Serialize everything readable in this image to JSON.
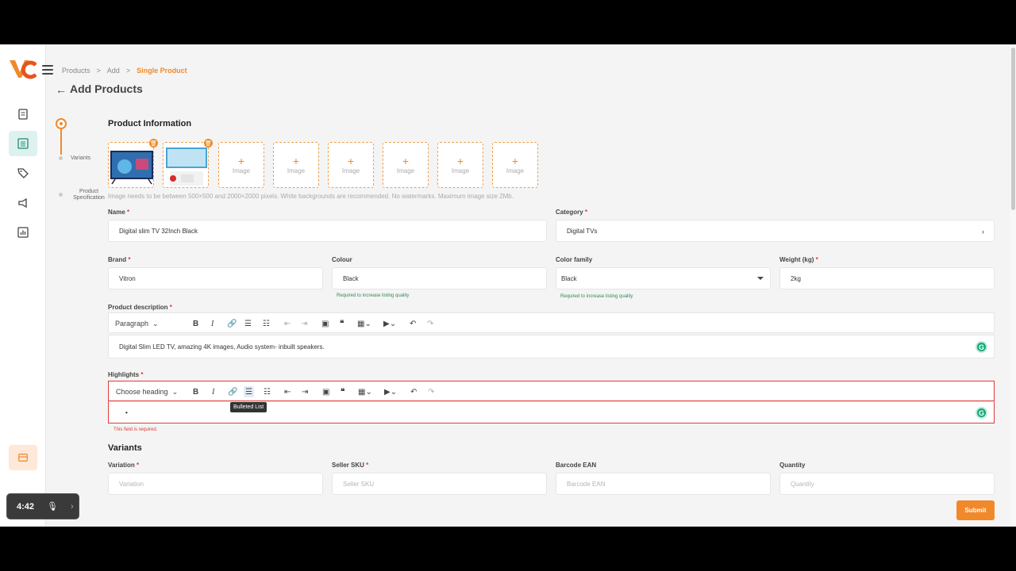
{
  "breadcrumb": {
    "items": [
      "Products",
      "Add",
      "Single Product"
    ],
    "separator": ">"
  },
  "page": {
    "title": "Add Products"
  },
  "stepper": {
    "steps": [
      "Variants",
      "Product Specification"
    ]
  },
  "product_info": {
    "title": "Product Information",
    "image_slot_label": "Image",
    "image_hint": "Image needs to be between 500×500 and 2000×2000 pixels. White backgrounds are recommended. No watermarks. Maximum image size 2Mb."
  },
  "fields": {
    "name": {
      "label": "Name",
      "value": "Digital slim TV 32Inch Black"
    },
    "category": {
      "label": "Category",
      "value": "Digital TVs"
    },
    "brand": {
      "label": "Brand",
      "value": "Vitron"
    },
    "colour": {
      "label": "Colour",
      "value": "Black",
      "help": "Required to increase listing quality"
    },
    "color_family": {
      "label": "Color family",
      "value": "Black",
      "help": "Required to increase listing quality"
    },
    "weight": {
      "label": "Weight (kg)",
      "value": "2kg"
    },
    "description": {
      "label": "Product description",
      "heading_select": "Paragraph",
      "content": "Digital Slim LED TV, amazing 4K images, Audio system- inbuilt speakers."
    },
    "highlights": {
      "label": "Highlights",
      "heading_select": "Choose heading",
      "bullet": "•",
      "error": "This field is required.",
      "tooltip": "Bulleted List"
    }
  },
  "variants": {
    "title": "Variants",
    "columns": [
      {
        "label": "Variation",
        "placeholder": "Variation",
        "required": true
      },
      {
        "label": "Seller SKU",
        "placeholder": "Seller SKU",
        "required": true
      },
      {
        "label": "Barcode EAN",
        "placeholder": "Barcode EAN",
        "required": false
      },
      {
        "label": "Quantity",
        "placeholder": "Quantity",
        "required": false
      }
    ]
  },
  "actions": {
    "submit": "Submit"
  },
  "recorder": {
    "time": "4:42"
  },
  "colors": {
    "accent": "#f0892a",
    "error": "#e03a3a",
    "active_nav": "#dff1ee"
  }
}
